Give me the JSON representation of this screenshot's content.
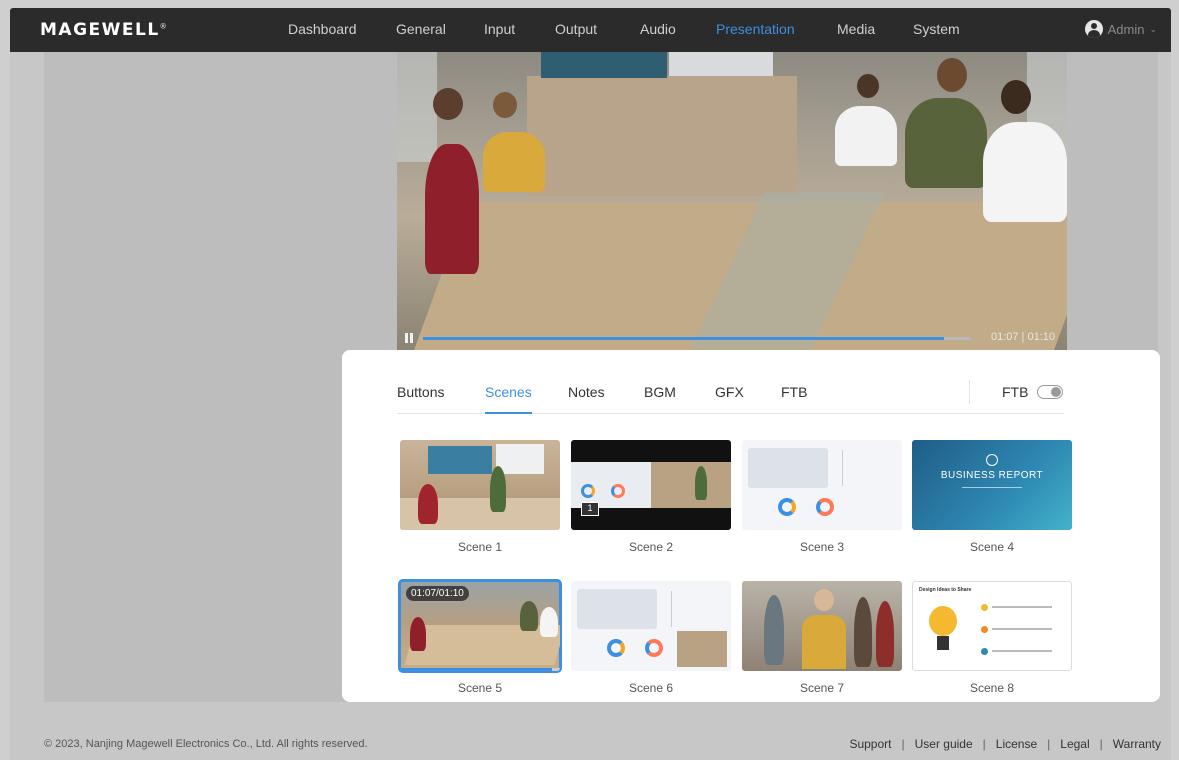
{
  "app": {
    "logo": "MAGEWELL",
    "logo_mark": "®"
  },
  "nav": {
    "items": [
      "Dashboard",
      "General",
      "Input",
      "Output",
      "Audio",
      "Presentation",
      "Media",
      "System"
    ],
    "active": "Presentation"
  },
  "user": {
    "name": "Admin",
    "icon": "user-avatar-icon",
    "dropdown_icon": "chevron-down-icon"
  },
  "player": {
    "time": "01:07 | 01:10",
    "progress": 0.95,
    "pause_icon": "pause-icon"
  },
  "panel": {
    "tabs": [
      "Buttons",
      "Scenes",
      "Notes",
      "BGM",
      "GFX",
      "FTB"
    ],
    "active_tab": "Scenes",
    "ftb_toggle_label": "FTB",
    "ftb_enabled": false
  },
  "scenes": [
    {
      "label": "Scene 1",
      "selected": false
    },
    {
      "label": "Scene 2",
      "selected": false,
      "badge": "1"
    },
    {
      "label": "Scene 3",
      "selected": false
    },
    {
      "label": "Scene 4",
      "selected": false,
      "thumb_text": "BUSINESS REPORT"
    },
    {
      "label": "Scene 5",
      "selected": true,
      "overlay_time": "01:07/01:10",
      "progress": 0.95
    },
    {
      "label": "Scene 6",
      "selected": false
    },
    {
      "label": "Scene 7",
      "selected": false
    },
    {
      "label": "Scene 8",
      "selected": false,
      "thumb_text": "Design Ideas to Share"
    }
  ],
  "footer": {
    "copyright": "© 2023, Nanjing Magewell Electronics Co., Ltd. All rights reserved.",
    "links": [
      "Support",
      "User guide",
      "License",
      "Legal",
      "Warranty"
    ],
    "separator": "|"
  },
  "colors": {
    "accent": "#3d8fe0",
    "topbar": "#2b2b2b",
    "overlay_bg": "#c7c7c7",
    "panel_bg": "#ffffff"
  }
}
